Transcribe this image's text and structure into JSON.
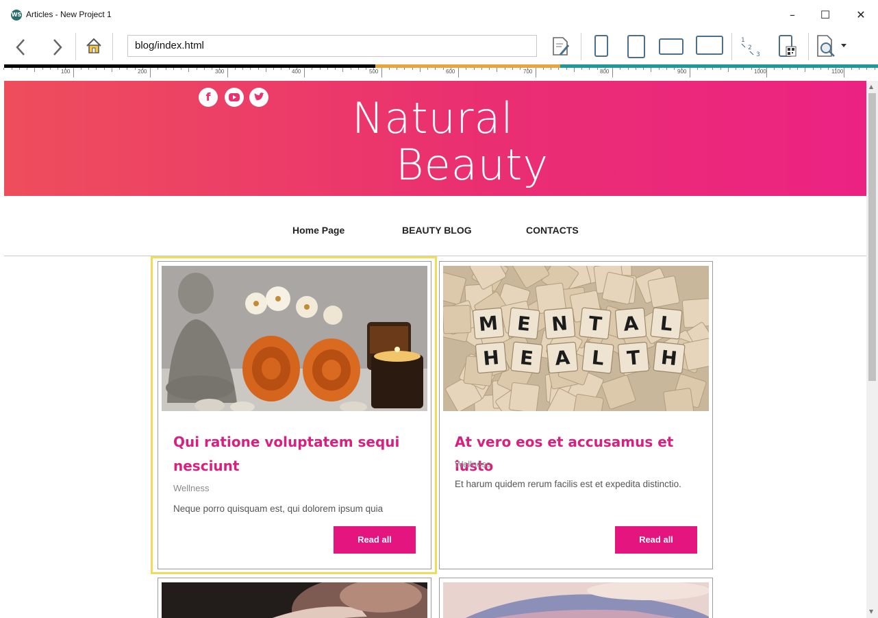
{
  "window": {
    "app_icon": "WS",
    "title": "Articles - New Project 1",
    "controls": {
      "minimize": "–",
      "maximize": "☐",
      "close": "✕"
    }
  },
  "toolbar": {
    "url": "blog/index.html",
    "icons": [
      "back-icon",
      "forward-icon",
      "home-icon",
      "edit-page-icon",
      "phone-portrait-icon",
      "tablet-portrait-icon",
      "tablet-landscape-icon",
      "desktop-icon",
      "tab-order-icon",
      "qr-preview-icon",
      "browser-preview-icon",
      "dropdown-arrow-icon"
    ]
  },
  "ruler": {
    "labels": [
      "100",
      "200",
      "300",
      "400",
      "500",
      "600",
      "700",
      "800",
      "900",
      "1000",
      "1100"
    ],
    "colors": {
      "segment1": "#000000",
      "segment2": "#e8a63a",
      "segment3": "#1d9a98"
    }
  },
  "site": {
    "social": [
      "facebook-icon",
      "youtube-icon",
      "twitter-icon"
    ],
    "hero_line1": "Natural",
    "hero_line2": "Beauty",
    "hero_colors": {
      "left": "#ee4e5c",
      "right": "#ec2283"
    },
    "nav": [
      "Home Page",
      "BEAUTY BLOG",
      "CONTACTS"
    ]
  },
  "cards": [
    {
      "title_line1": "Qui ratione voluptatem sequi",
      "title_line2": "nesciunt",
      "category": "Wellness",
      "text": "Neque porro quisquam est, qui dolorem ipsum quia",
      "button": "Read all",
      "image": "spa-towels-candles-buddha"
    },
    {
      "title_line1": "At vero eos et accusamus et iusto",
      "category": "Wellness",
      "text": "Et harum quidem rerum facilis est et expedita distinctio.",
      "button": "Read all",
      "image": "mental-health-scrabble-tiles",
      "tiles": [
        "M",
        "E",
        "N",
        "T",
        "A",
        "L",
        "H",
        "E",
        "A",
        "L",
        "T",
        "H"
      ]
    }
  ],
  "accent": "#e5157f"
}
